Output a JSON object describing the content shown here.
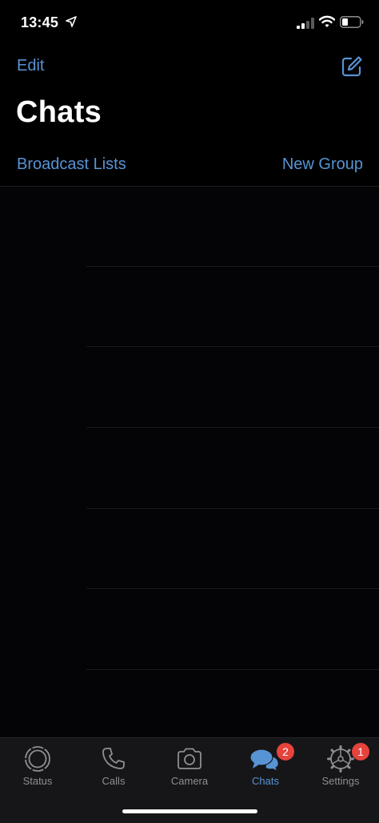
{
  "status_bar": {
    "time": "13:45",
    "icons": [
      "location-arrow-icon",
      "cellular-signal-icon",
      "wifi-icon",
      "battery-icon"
    ]
  },
  "header": {
    "edit_label": "Edit",
    "compose_icon": "compose-icon",
    "title": "Chats",
    "broadcast_label": "Broadcast Lists",
    "new_group_label": "New Group"
  },
  "chat_list": {
    "rows": [
      {},
      {},
      {},
      {},
      {},
      {},
      {}
    ]
  },
  "tab_bar": {
    "tabs": [
      {
        "label": "Status",
        "icon": "status-icon",
        "badge": ""
      },
      {
        "label": "Calls",
        "icon": "phone-icon",
        "badge": ""
      },
      {
        "label": "Camera",
        "icon": "camera-icon",
        "badge": ""
      },
      {
        "label": "Chats",
        "icon": "chat-bubbles-icon",
        "badge": "2"
      },
      {
        "label": "Settings",
        "icon": "gear-icon",
        "badge": "1"
      }
    ],
    "active_tab": "Chats"
  },
  "colors": {
    "accent": "#5893d4",
    "background": "#000000",
    "tab_bar_background": "#161618",
    "inactive_tab": "#8e8e93",
    "badge": "#e5433c"
  }
}
